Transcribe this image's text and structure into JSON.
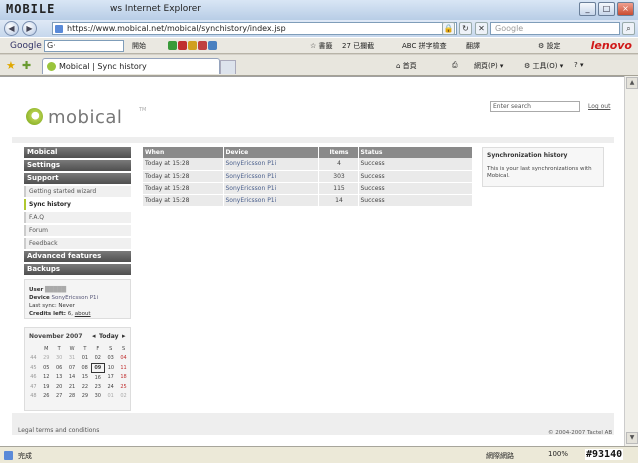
{
  "browser": {
    "watermark_logo": "MOBILE",
    "window_title": "ws Internet Explorer",
    "url": "https://www.mobical.net/mobical/synchistory/index.jsp",
    "search_placeholder": "Google",
    "tab_title": "Mobical | Sync history",
    "status_text": "完成",
    "zone_text": "網際網路",
    "zoom_text": "100%",
    "watermark_id": "#93140"
  },
  "googlebar": {
    "label": "Google",
    "input_value": "G·",
    "items": [
      "開始",
      "書籤",
      "27 已攔截",
      "拼字檢查",
      "翻譯",
      "設定"
    ],
    "lenovo": "lenovo"
  },
  "commandbar": [
    "首頁",
    "網頁(P)",
    "工具(O)"
  ],
  "site": {
    "brand": "mobical",
    "tm": "TM",
    "search_value": "Enter search",
    "logout": "Log out",
    "footer_left": "Legal terms and conditions",
    "footer_right": "© 2004-2007 Tactel AB"
  },
  "sidebar": {
    "mobical": "Mobical",
    "settings": "Settings",
    "support": "Support",
    "sub": [
      "Getting started wizard",
      "Sync history",
      "F.A.Q",
      "Forum",
      "Feedback"
    ],
    "advanced": "Advanced features",
    "backups": "Backups"
  },
  "user": {
    "user_label": "User",
    "user_value": "█████",
    "device_label": "Device",
    "device_value": "SonyEricsson P1i",
    "last_sync": "Last sync: Never",
    "credits_label": "Credits left:",
    "credits_value": "6,",
    "credits_link": "about"
  },
  "calendar": {
    "month": "November 2007",
    "today": "Today",
    "weekdays": [
      "M",
      "T",
      "W",
      "T",
      "F",
      "S",
      "S"
    ],
    "weeks": [
      {
        "wk": "44",
        "days": [
          "29",
          "30",
          "31",
          "01",
          "02",
          "03",
          "04"
        ]
      },
      {
        "wk": "45",
        "days": [
          "05",
          "06",
          "07",
          "08",
          "09",
          "10",
          "11"
        ]
      },
      {
        "wk": "46",
        "days": [
          "12",
          "13",
          "14",
          "15",
          "16",
          "17",
          "18"
        ]
      },
      {
        "wk": "47",
        "days": [
          "19",
          "20",
          "21",
          "22",
          "23",
          "24",
          "25"
        ]
      },
      {
        "wk": "48",
        "days": [
          "26",
          "27",
          "28",
          "29",
          "30",
          "01",
          "02"
        ]
      }
    ]
  },
  "history": {
    "columns": [
      "When",
      "Device",
      "Items",
      "Status"
    ],
    "rows": [
      {
        "when": "Today at 15:28",
        "device": "SonyEricsson P1i",
        "items": "4",
        "status": "Success"
      },
      {
        "when": "Today at 15:28",
        "device": "SonyEricsson P1i",
        "items": "303",
        "status": "Success"
      },
      {
        "when": "Today at 15:28",
        "device": "SonyEricsson P1i",
        "items": "115",
        "status": "Success"
      },
      {
        "when": "Today at 15:28",
        "device": "SonyEricsson P1i",
        "items": "14",
        "status": "Success"
      }
    ]
  },
  "info": {
    "title": "Synchronization history",
    "text": "This is your last synchronizations with Mobical."
  },
  "colors": {
    "accent": "#b0c830",
    "header_gray": "#8a8a8a",
    "sidebar_dark": "#555555"
  }
}
